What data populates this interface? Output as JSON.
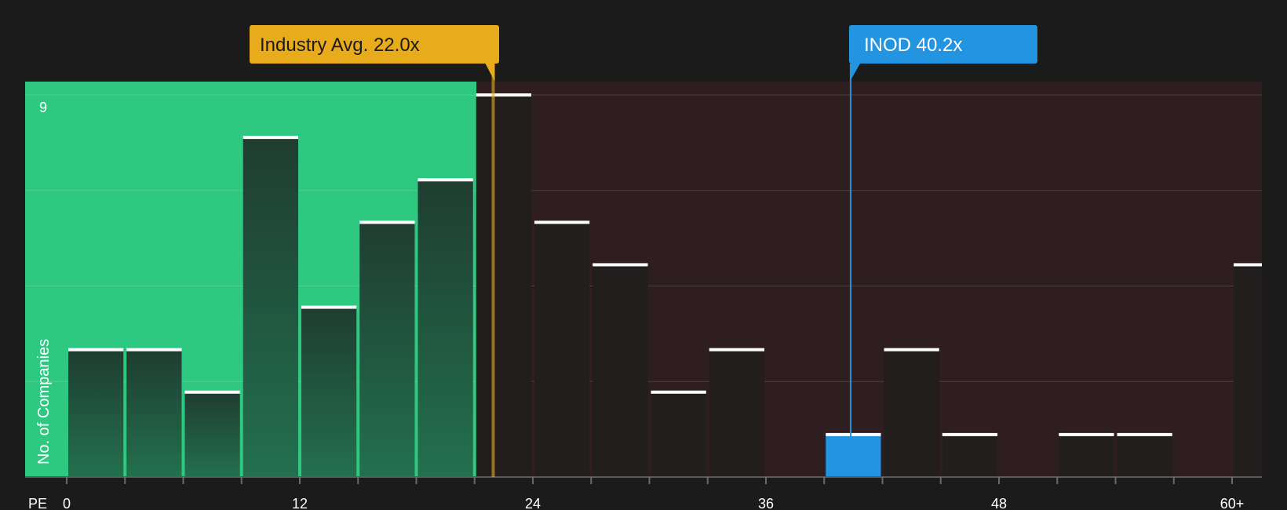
{
  "chart_data": {
    "type": "bar",
    "xlabel": "PE",
    "ylabel": "No. of Companies",
    "x_ticks": [
      "0",
      "12",
      "24",
      "36",
      "48",
      "60+"
    ],
    "y_max_label": "9",
    "ylim": [
      0,
      9
    ],
    "bin_width": 3,
    "bins": [
      {
        "x_start": 0,
        "value": 3
      },
      {
        "x_start": 3,
        "value": 3
      },
      {
        "x_start": 6,
        "value": 2
      },
      {
        "x_start": 9,
        "value": 8
      },
      {
        "x_start": 12,
        "value": 4
      },
      {
        "x_start": 15,
        "value": 6
      },
      {
        "x_start": 18,
        "value": 7
      },
      {
        "x_start": 21,
        "value": 9
      },
      {
        "x_start": 24,
        "value": 6
      },
      {
        "x_start": 27,
        "value": 5
      },
      {
        "x_start": 30,
        "value": 2
      },
      {
        "x_start": 33,
        "value": 3
      },
      {
        "x_start": 36,
        "value": 0
      },
      {
        "x_start": 39,
        "value": 1,
        "highlight": true
      },
      {
        "x_start": 42,
        "value": 3
      },
      {
        "x_start": 45,
        "value": 1
      },
      {
        "x_start": 48,
        "value": 0
      },
      {
        "x_start": 51,
        "value": 1
      },
      {
        "x_start": 54,
        "value": 1
      },
      {
        "x_start": 57,
        "value": 0
      },
      {
        "x_start": 60,
        "value": 5
      }
    ],
    "industry_avg": {
      "label": "Industry Avg. 22.0x",
      "value": 22.0
    },
    "company": {
      "label": "INOD 40.2x",
      "value": 40.2
    },
    "colors": {
      "background": "#1b1b1b",
      "below_zone": "#2ec880",
      "above_zone": "#2e1e1f",
      "bar_below": "#1e4a36",
      "bar_above": "#221e1e",
      "bar_highlight": "#2394e0",
      "industry": "#e8ab1c",
      "company": "#2394e0"
    }
  }
}
